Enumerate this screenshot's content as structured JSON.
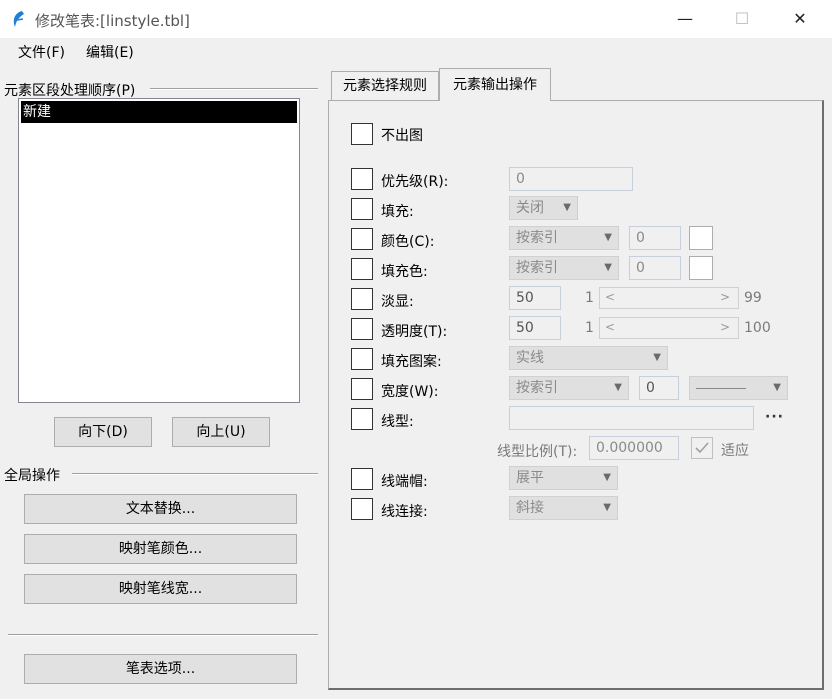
{
  "window": {
    "title": "修改笔表:[linstyle.tbl]",
    "minimize": "—",
    "maximize": "☐",
    "close": "✕"
  },
  "menu": {
    "file": "文件(F)",
    "edit": "编辑(E)"
  },
  "left": {
    "group_order": "元素区段处理顺序(P)",
    "list_items": [
      "新建"
    ],
    "btn_down": "向下(D)",
    "btn_up": "向上(U)",
    "group_global": "全局操作",
    "btn_text_replace": "文本替换...",
    "btn_map_color": "映射笔颜色...",
    "btn_map_width": "映射笔线宽...",
    "btn_options": "笔表选项..."
  },
  "tabs": [
    {
      "label": "元素选择规则"
    },
    {
      "label": "元素输出操作"
    }
  ],
  "output": {
    "no_output": "不出图",
    "priority": {
      "label": "优先级(R):",
      "value": "0"
    },
    "fill": {
      "label": "填充:",
      "value": "关闭"
    },
    "color": {
      "label": "颜色(C):",
      "mode": "按索引",
      "index": "0"
    },
    "fill_color": {
      "label": "填充色:",
      "mode": "按索引",
      "index": "0"
    },
    "fade": {
      "label": "淡显:",
      "value": "50",
      "min": "1",
      "max": "99"
    },
    "transparency": {
      "label": "透明度(T):",
      "value": "50",
      "min": "1",
      "max": "100"
    },
    "fill_pattern": {
      "label": "填充图案:",
      "value": "实线"
    },
    "width": {
      "label": "宽度(W):",
      "mode": "按索引",
      "index": "0"
    },
    "linetype": {
      "label": "线型:",
      "value": "",
      "browse": "···"
    },
    "linetype_scale": {
      "label": "线型比例(T):",
      "value": "0.000000",
      "fit_label": "适应"
    },
    "cap": {
      "label": "线端帽:",
      "value": "展平"
    },
    "join": {
      "label": "线连接:",
      "value": "斜接"
    }
  },
  "colors": {
    "selection_bg": "#000000",
    "disabled_text": "#8a8a8a",
    "button_bg": "#e1e1e1"
  }
}
